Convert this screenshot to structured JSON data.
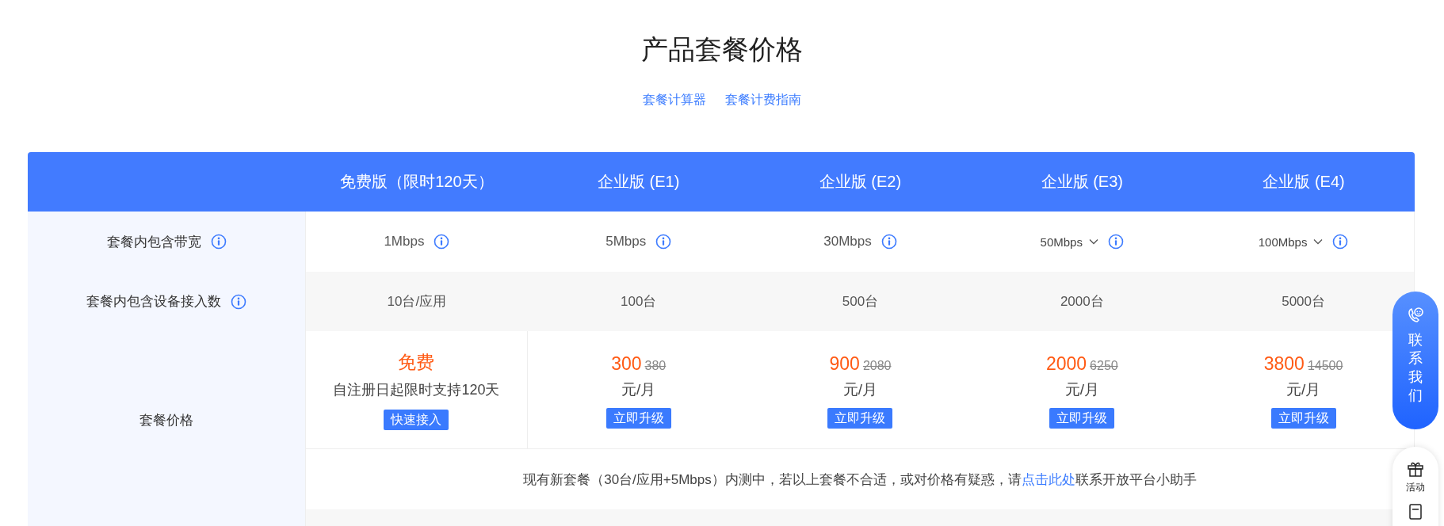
{
  "title": "产品套餐价格",
  "links": [
    {
      "label": "套餐计算器"
    },
    {
      "label": "套餐计费指南"
    }
  ],
  "table": {
    "columns": [
      "免费版（限时120天）",
      "企业版 (E1)",
      "企业版 (E2)",
      "企业版 (E3)",
      "企业版 (E4)"
    ],
    "rows": [
      {
        "kind": "plain",
        "label": "套餐内包含带宽",
        "info": true,
        "cells": [
          {
            "text": "1Mbps",
            "info": true,
            "dropdown": false
          },
          {
            "text": "5Mbps",
            "info": true,
            "dropdown": false
          },
          {
            "text": "30Mbps",
            "info": true,
            "dropdown": false
          },
          {
            "text": "50Mbps",
            "info": true,
            "dropdown": true
          },
          {
            "text": "100Mbps",
            "info": true,
            "dropdown": true
          }
        ]
      },
      {
        "kind": "plain",
        "label": "套餐内包含设备接入数",
        "info": true,
        "cells": [
          {
            "text": "10台/应用",
            "info": false,
            "dropdown": false
          },
          {
            "text": "100台",
            "info": false,
            "dropdown": false
          },
          {
            "text": "500台",
            "info": false,
            "dropdown": false
          },
          {
            "text": "2000台",
            "info": false,
            "dropdown": false
          },
          {
            "text": "5000台",
            "info": false,
            "dropdown": false
          }
        ]
      },
      {
        "kind": "price",
        "label": "套餐价格",
        "info": false,
        "cells": [
          {
            "kind": "free",
            "price": "免费",
            "note": "自注册日起限时支持120天",
            "button": "快速接入"
          },
          {
            "kind": "paid",
            "price": "300",
            "original": "380",
            "unit": "元/月",
            "button": "立即升级"
          },
          {
            "kind": "paid",
            "price": "900",
            "original": "2080",
            "unit": "元/月",
            "button": "立即升级"
          },
          {
            "kind": "paid",
            "price": "2000",
            "original": "6250",
            "unit": "元/月",
            "button": "立即升级"
          },
          {
            "kind": "paid",
            "price": "3800",
            "original": "14500",
            "unit": "元/月",
            "button": "立即升级"
          }
        ],
        "notice": {
          "before": "现有新套餐（30台/应用+5Mbps）内测中，若以上套餐不合适，或对价格有疑惑，请",
          "link": "点击此处",
          "after": "联系开放平台小助手"
        }
      }
    ]
  },
  "contact": {
    "label": "联系我们"
  },
  "side_tools": [
    {
      "kind": "gift",
      "label": "活动"
    },
    {
      "kind": "document"
    }
  ]
}
